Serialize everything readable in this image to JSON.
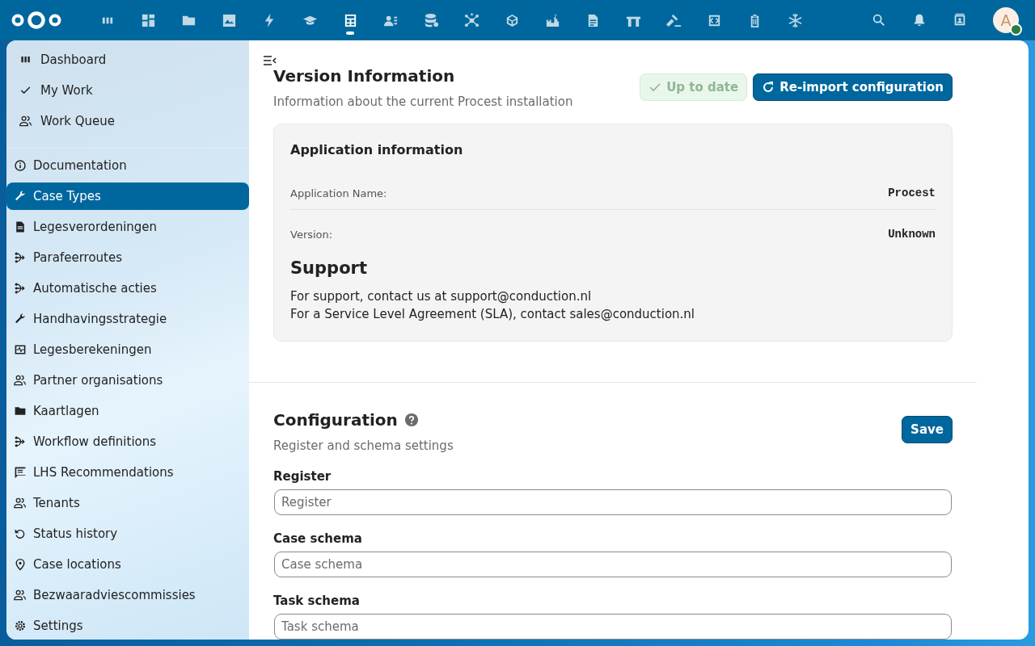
{
  "header": {
    "apps": [
      {
        "selected": false
      },
      {
        "selected": false
      },
      {
        "selected": false
      },
      {
        "selected": false
      },
      {
        "selected": false
      },
      {
        "selected": false
      },
      {
        "selected": true
      },
      {
        "selected": false
      },
      {
        "selected": false
      },
      {
        "selected": false
      },
      {
        "selected": false
      },
      {
        "selected": false
      },
      {
        "selected": false
      },
      {
        "selected": false
      },
      {
        "selected": false
      },
      {
        "selected": false
      },
      {
        "selected": false
      },
      {
        "selected": false
      }
    ],
    "avatar": {
      "initial": "A",
      "online": true
    }
  },
  "sidebar": {
    "top_items": [
      {
        "label": "Dashboard"
      },
      {
        "label": "My Work"
      },
      {
        "label": "Work Queue"
      }
    ],
    "items": [
      {
        "label": "Documentation",
        "selected": false
      },
      {
        "label": "Case Types",
        "selected": true
      },
      {
        "label": "Legesverordeningen",
        "selected": false
      },
      {
        "label": "Parafeerroutes",
        "selected": false
      },
      {
        "label": "Automatische acties",
        "selected": false
      },
      {
        "label": "Handhavingsstrategie",
        "selected": false
      },
      {
        "label": "Legesberekeningen",
        "selected": false
      },
      {
        "label": "Partner organisations",
        "selected": false
      },
      {
        "label": "Kaartlagen",
        "selected": false
      },
      {
        "label": "Workflow definitions",
        "selected": false
      },
      {
        "label": "LHS Recommendations",
        "selected": false
      },
      {
        "label": "Tenants",
        "selected": false
      },
      {
        "label": "Status history",
        "selected": false
      },
      {
        "label": "Case locations",
        "selected": false
      },
      {
        "label": "Bezwaaradviescommissies",
        "selected": false
      },
      {
        "label": "Settings",
        "selected": false
      }
    ]
  },
  "version": {
    "title": "Version Information",
    "subtitle": "Information about the current Procest installation",
    "status": {
      "label": "Up to date",
      "disabled": true
    },
    "reimport_button": "Re-import configuration",
    "card": {
      "title": "Application information",
      "rows": [
        {
          "label": "Application Name:",
          "value": "Procest"
        },
        {
          "label": "Version:",
          "value": "Unknown"
        }
      ],
      "support_title": "Support",
      "support_lines": [
        "For support, contact us at support@conduction.nl",
        "For a Service Level Agreement (SLA), contact sales@conduction.nl"
      ]
    }
  },
  "configuration": {
    "title": "Configuration",
    "subtitle": "Register and schema settings",
    "save_button": "Save",
    "fields": [
      {
        "label": "Register",
        "placeholder": "Register"
      },
      {
        "label": "Case schema",
        "placeholder": "Case schema"
      },
      {
        "label": "Task schema",
        "placeholder": "Task schema"
      }
    ]
  }
}
